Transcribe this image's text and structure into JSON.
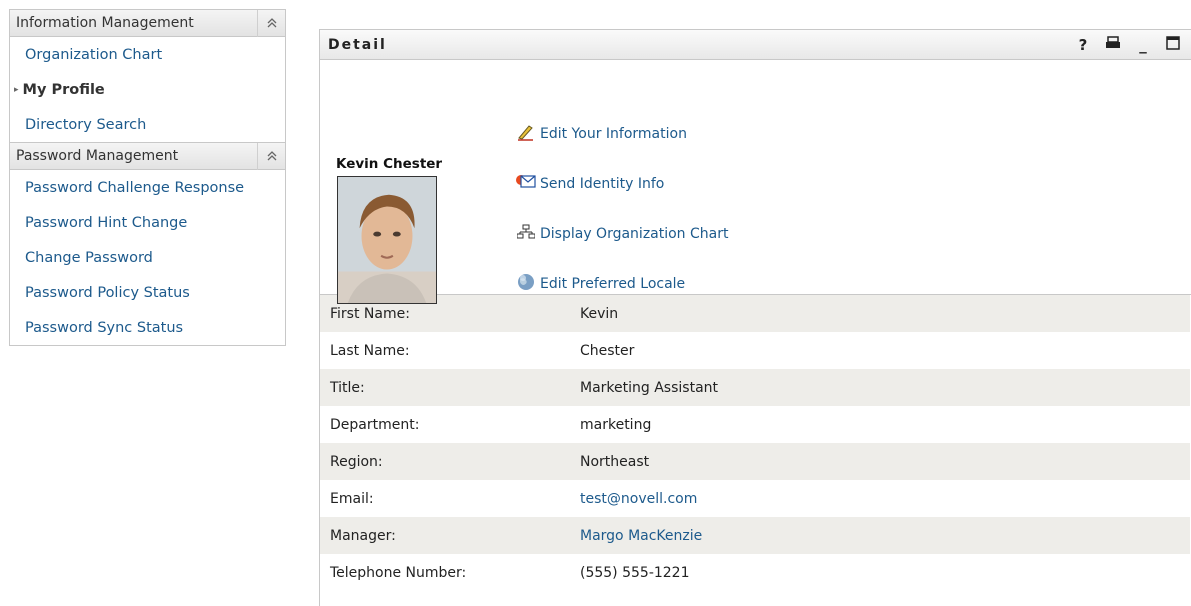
{
  "sidebar": {
    "sections": [
      {
        "title": "Information Management",
        "items": [
          {
            "label": "Organization Chart",
            "active": false
          },
          {
            "label": "My Profile",
            "active": true
          },
          {
            "label": "Directory Search",
            "active": false
          }
        ]
      },
      {
        "title": "Password Management",
        "items": [
          {
            "label": "Password Challenge Response",
            "active": false
          },
          {
            "label": "Password Hint Change",
            "active": false
          },
          {
            "label": "Change Password",
            "active": false
          },
          {
            "label": "Password Policy Status",
            "active": false
          },
          {
            "label": "Password Sync Status",
            "active": false
          }
        ]
      }
    ],
    "collapse_glyph": "»"
  },
  "panel": {
    "title": "Detail",
    "tools": {
      "help": "?",
      "print": "⎙",
      "minimize": "_",
      "maximize": "□"
    }
  },
  "profile": {
    "name": "Kevin Chester",
    "actions": [
      {
        "label": "Edit Your Information",
        "icon": "pencil-icon"
      },
      {
        "label": "Send Identity Info",
        "icon": "envelope-icon"
      },
      {
        "label": "Display Organization Chart",
        "icon": "org-chart-icon"
      },
      {
        "label": "Edit Preferred Locale",
        "icon": "globe-icon"
      }
    ]
  },
  "details": [
    {
      "label": "First Name:",
      "value": "Kevin",
      "link": false
    },
    {
      "label": "Last Name:",
      "value": "Chester",
      "link": false
    },
    {
      "label": "Title:",
      "value": "Marketing Assistant",
      "link": false
    },
    {
      "label": "Department:",
      "value": "marketing",
      "link": false
    },
    {
      "label": "Region:",
      "value": "Northeast",
      "link": false
    },
    {
      "label": "Email:",
      "value": "test@novell.com",
      "link": true
    },
    {
      "label": "Manager:",
      "value": "Margo MacKenzie",
      "link": true
    },
    {
      "label": "Telephone Number:",
      "value": "(555) 555-1221",
      "link": false
    }
  ],
  "colors": {
    "link": "#1d5a8c",
    "row_shade": "#eeede9"
  }
}
